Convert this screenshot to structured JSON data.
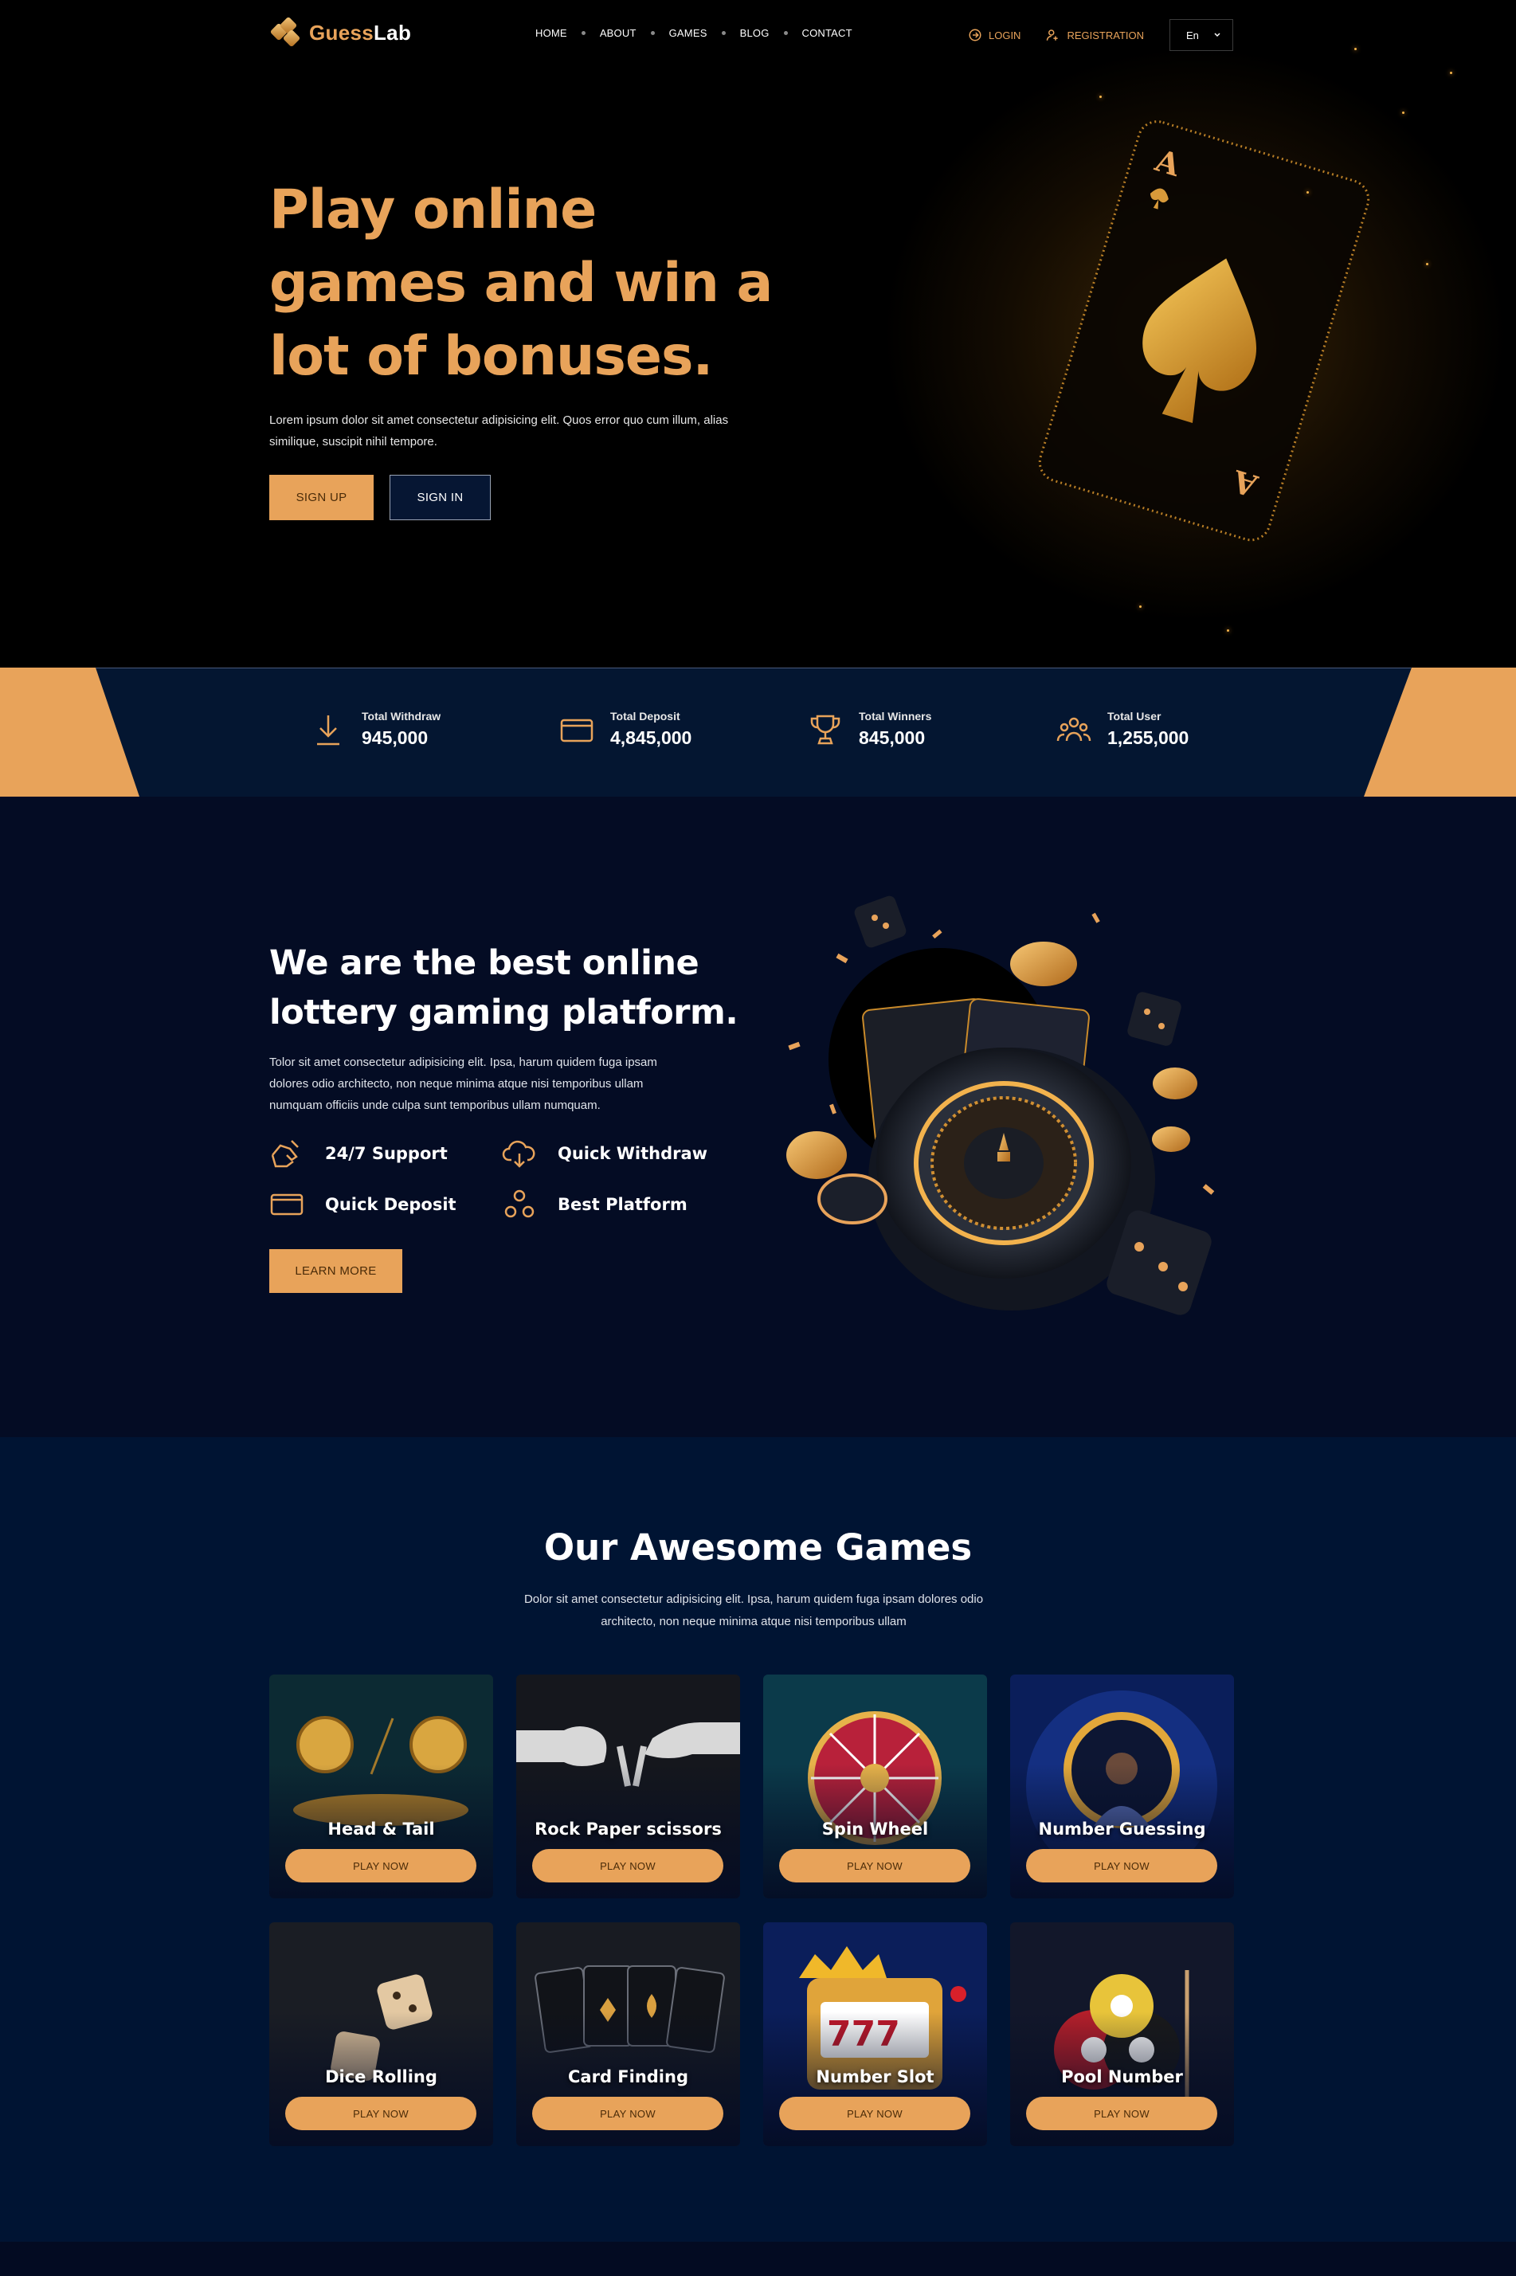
{
  "brand": {
    "name_part1": "Guess",
    "name_part2": "Lab"
  },
  "nav": {
    "items": [
      "HOME",
      "ABOUT",
      "GAMES",
      "BLOG",
      "CONTACT"
    ],
    "login": "LOGIN",
    "registration": "REGISTRATION",
    "language": "En"
  },
  "hero": {
    "title": "Play online games and win a lot of bonuses.",
    "text": "Lorem ipsum dolor sit amet consectetur adipisicing elit. Quos error quo cum illum, alias similique, suscipit nihil tempore.",
    "signup": "SIGN UP",
    "signin": "SIGN IN"
  },
  "stats": [
    {
      "label": "Total Withdraw",
      "value": "945,000",
      "icon": "download-icon"
    },
    {
      "label": "Total Deposit",
      "value": "4,845,000",
      "icon": "card-icon"
    },
    {
      "label": "Total Winners",
      "value": "845,000",
      "icon": "trophy-icon"
    },
    {
      "label": "Total User",
      "value": "1,255,000",
      "icon": "users-icon"
    }
  ],
  "about": {
    "title": "We are the best online lottery gaming platform.",
    "text": "Tolor sit amet consectetur adipisicing elit. Ipsa, harum quidem fuga ipsam dolores odio architecto, non neque minima atque nisi temporibus ullam numquam officiis unde culpa sunt temporibus ullam numquam.",
    "features": [
      {
        "label": "24/7 Support",
        "icon": "support-hand-icon"
      },
      {
        "label": "Quick Withdraw",
        "icon": "cloud-download-icon"
      },
      {
        "label": "Quick Deposit",
        "icon": "card-icon"
      },
      {
        "label": "Best Platform",
        "icon": "cubes-icon"
      }
    ],
    "learn_more": "LEARN MORE"
  },
  "games": {
    "title": "Our Awesome Games",
    "subtitle": "Dolor sit amet consectetur adipisicing elit. Ipsa, harum quidem fuga ipsam dolores odio architecto, non neque minima atque nisi temporibus ullam",
    "play_label": "PLAY NOW",
    "items": [
      {
        "name": "Head & Tail",
        "art": "coins"
      },
      {
        "name": "Rock Paper scissors",
        "art": "hands"
      },
      {
        "name": "Spin Wheel",
        "art": "wheel"
      },
      {
        "name": "Number Guessing",
        "art": "guess"
      },
      {
        "name": "Dice Rolling",
        "art": "dice"
      },
      {
        "name": "Card Finding",
        "art": "cards"
      },
      {
        "name": "Number Slot",
        "art": "slot"
      },
      {
        "name": "Pool Number",
        "art": "pool"
      }
    ]
  },
  "colors": {
    "accent": "#e8a35a",
    "navy": "#041631",
    "dark": "#040c24"
  }
}
